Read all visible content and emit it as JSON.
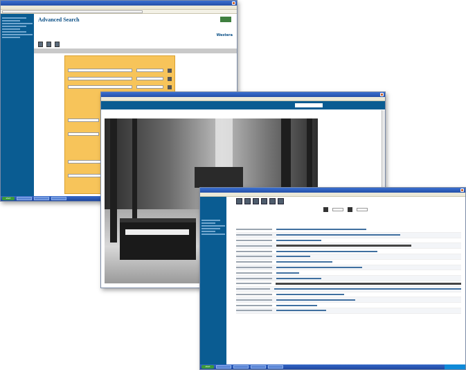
{
  "windows": {
    "search": {
      "page_title": "Advanced Search",
      "brand": "Westera"
    },
    "viewer": {
      "caption": ""
    },
    "record": {
      "title": "",
      "pager_label": ""
    }
  },
  "taskbar": {
    "start_label": "start"
  },
  "colors": {
    "sidebar": "#0a5c92",
    "form_bg": "#f7c45a",
    "titlebar": "#2450a8",
    "taskbar": "#1f47a0"
  }
}
